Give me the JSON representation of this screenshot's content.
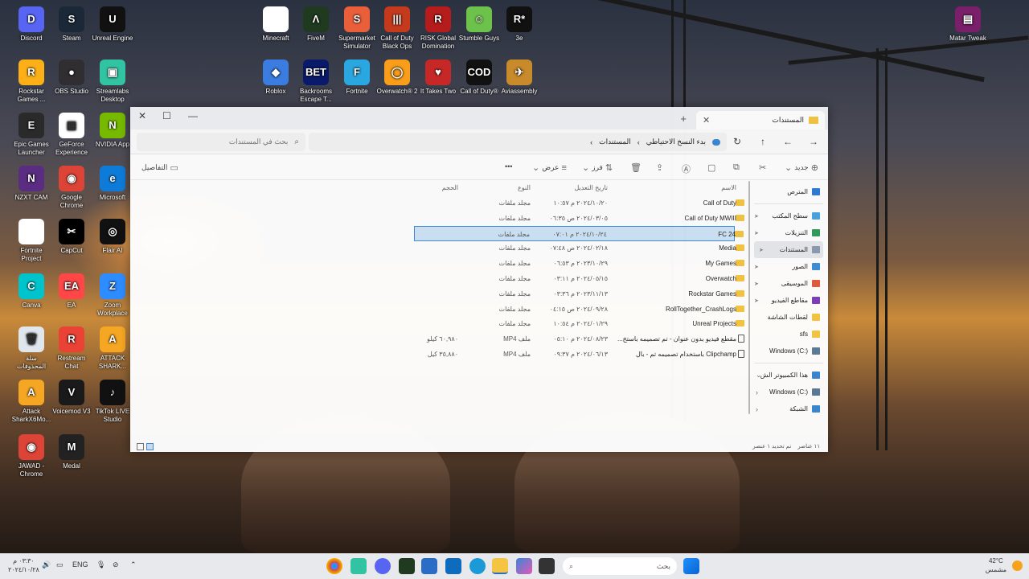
{
  "desktop": {
    "icons": [
      {
        "label": "Discord",
        "color": "#5865F2",
        "glyph": "D"
      },
      {
        "label": "Steam",
        "color": "#1b2838",
        "glyph": "S"
      },
      {
        "label": "Unreal Engine",
        "color": "#111111",
        "glyph": "U"
      },
      {
        "label": "Rockstar Games ...",
        "color": "#fcaf17",
        "glyph": "R"
      },
      {
        "label": "OBS Studio",
        "color": "#302e31",
        "glyph": "●"
      },
      {
        "label": "Streamlabs Desktop",
        "color": "#31c3a2",
        "glyph": "▣"
      },
      {
        "label": "Epic Games Launcher",
        "color": "#2a2a2a",
        "glyph": "E"
      },
      {
        "label": "GeForce Experience",
        "color": "#ffffff",
        "glyph": "▦"
      },
      {
        "label": "NVIDIA App",
        "color": "#76b900",
        "glyph": "N"
      },
      {
        "label": "NZXT CAM",
        "color": "#5a2d82",
        "glyph": "N"
      },
      {
        "label": "Google Chrome",
        "color": "#db4437",
        "glyph": "◉"
      },
      {
        "label": "Microsoft",
        "color": "#0f7bd8",
        "glyph": "e"
      },
      {
        "label": "Fortnite Project",
        "color": "#ffffff",
        "glyph": ""
      },
      {
        "label": "CapCut",
        "color": "#000000",
        "glyph": "✂"
      },
      {
        "label": "Flair AI",
        "color": "#111111",
        "glyph": "◎"
      },
      {
        "label": "Canva",
        "color": "#00c4cc",
        "glyph": "C"
      },
      {
        "label": "EA",
        "color": "#ff4747",
        "glyph": "EA"
      },
      {
        "label": "Zoom Workplace",
        "color": "#2d8cff",
        "glyph": "Z"
      },
      {
        "label": "سلة المحذوفات",
        "color": "#dfe6ee",
        "glyph": "🗑"
      },
      {
        "label": "Restream Chat",
        "color": "#ea4335",
        "glyph": "R"
      },
      {
        "label": "ATTACK SHARK...",
        "color": "#f5a623",
        "glyph": "A"
      },
      {
        "label": "Attack SharkX6Mo...",
        "color": "#f5a623",
        "glyph": "A"
      },
      {
        "label": "Voicemod V3",
        "color": "#1a1a1a",
        "glyph": "V"
      },
      {
        "label": "TikTok LIVE Studio",
        "color": "#111111",
        "glyph": "♪"
      },
      {
        "label": "JAWAD - Chrome",
        "color": "#db4437",
        "glyph": "◉"
      },
      {
        "label": "Medal",
        "color": "#222222",
        "glyph": "M"
      },
      {
        "label": "Minecraft",
        "color": "#ffffff",
        "glyph": ""
      },
      {
        "label": "FiveM",
        "color": "#1f3a1f",
        "glyph": "Λ"
      },
      {
        "label": "Supermarket Simulator",
        "color": "#e85f3a",
        "glyph": "S"
      },
      {
        "label": "Call of Duty Black Ops",
        "color": "#c53a1c",
        "glyph": "|||"
      },
      {
        "label": "RISK Global Domination",
        "color": "#b71c1c",
        "glyph": "R"
      },
      {
        "label": "Stumble Guys",
        "color": "#6cc24a",
        "glyph": "☺"
      },
      {
        "label": "3e",
        "color": "#111111",
        "glyph": "R*"
      },
      {
        "label": "Roblox",
        "color": "#3a7ce0",
        "glyph": "◆"
      },
      {
        "label": "Backrooms Escape T...",
        "color": "#0a1a6a",
        "glyph": "BET"
      },
      {
        "label": "Fortnite",
        "color": "#2aa7e0",
        "glyph": "F"
      },
      {
        "label": "Overwatch® 2",
        "color": "#f99e1a",
        "glyph": "◯"
      },
      {
        "label": "It Takes Two",
        "color": "#c62828",
        "glyph": "♥"
      },
      {
        "label": "Call of Duty®",
        "color": "#111111",
        "glyph": "COD"
      },
      {
        "label": "Aviassembly",
        "color": "#c88a2a",
        "glyph": "✈"
      },
      {
        "label": "Matar Tweak",
        "color": "#7a1f6a",
        "glyph": "▤"
      }
    ]
  },
  "explorer": {
    "tab_title": "المستندات",
    "tab_close": "✕",
    "new_tab": "+",
    "window_controls": {
      "minimize": "—",
      "maximize": "☐",
      "close": "✕"
    },
    "nav": {
      "back": "→",
      "forward": "←",
      "up": "↑",
      "refresh": "↻"
    },
    "breadcrumb": {
      "root": "بدء النسخ الاحتياطي",
      "sep1": "›",
      "current": "المستندات",
      "sep2": "›"
    },
    "search_placeholder": "بحث في المستندات",
    "toolbar": {
      "new": "جديد",
      "sort": "فرز",
      "view": "عرض",
      "more": "•••",
      "details": "التفاصيل"
    },
    "columns": {
      "name": "الاسم",
      "date": "تاريخ التعديل",
      "type": "النوع",
      "size": "الحجم"
    },
    "files": [
      {
        "name": "Call of Duty",
        "date": "٢٠٢٤/١٠/٢٠ م ١٠:٥٧",
        "type": "مجلد ملفات",
        "size": "",
        "kind": "folder",
        "selected": false
      },
      {
        "name": "Call of Duty MWIII",
        "date": "٢٠٢٤/٠٣/٠٥ ص ٠٦:٣٥",
        "type": "مجلد ملفات",
        "size": "",
        "kind": "folder",
        "selected": false
      },
      {
        "name": "FC 24",
        "date": "٢٠٢٤/١٠/٢٤ م ٠٧:٠١",
        "type": "مجلد ملفات",
        "size": "",
        "kind": "folder",
        "selected": true
      },
      {
        "name": "Media",
        "date": "٢٠٢٤/٠٢/١٨ ص ٠٧:٤٨",
        "type": "مجلد ملفات",
        "size": "",
        "kind": "folder",
        "selected": false
      },
      {
        "name": "My Games",
        "date": "٢٠٢٣/١٠/٢٩ م ٠٦:٥٣",
        "type": "مجلد ملفات",
        "size": "",
        "kind": "folder",
        "selected": false
      },
      {
        "name": "Overwatch",
        "date": "٢٠٢٤/٠٥/١٥ م ٠٣:١١",
        "type": "مجلد ملفات",
        "size": "",
        "kind": "folder",
        "selected": false
      },
      {
        "name": "Rockstar Games",
        "date": "٢٠٢٣/١١/١٣ م ٠٣:٣٦",
        "type": "مجلد ملفات",
        "size": "",
        "kind": "folder",
        "selected": false
      },
      {
        "name": "RollTogether_CrashLogs",
        "date": "٢٠٢٤/٠٩/٢٨ ص ٠٤:١٥",
        "type": "مجلد ملفات",
        "size": "",
        "kind": "folder",
        "selected": false
      },
      {
        "name": "Unreal Projects",
        "date": "٢٠٢٤/٠١/٢٩ م ١٠:٥٤",
        "type": "مجلد ملفات",
        "size": "",
        "kind": "folder",
        "selected": false
      },
      {
        "name": "مقطع فيديو بدون عنوان - تم تصميمه باستخ...",
        "date": "٢٠٢٤/٠٨/٢٣ م ٠٥:١٠",
        "type": "ملف MP4",
        "size": "٦٠,٩٨٠ كيلو",
        "kind": "video",
        "selected": false
      },
      {
        "name": "Clipchamp باستخدام تصميمه تم - بال",
        "date": "٢٠٢٤/٠٦/١٣ م ٠٩:٣٧",
        "type": "ملف MP4",
        "size": "٣٥,٨٨٠ كيل",
        "kind": "video",
        "selected": false
      }
    ],
    "sidebar": [
      {
        "label": "المترص",
        "color": "#2d7bd6",
        "active": false,
        "pin": false,
        "chev": false
      },
      {
        "label": "سطح المكتب",
        "color": "#4aa3df",
        "active": false,
        "pin": true,
        "chev": false
      },
      {
        "label": "التنزيلات",
        "color": "#2e9e58",
        "active": false,
        "pin": true,
        "chev": false
      },
      {
        "label": "المستندات",
        "color": "#8a9bb0",
        "active": true,
        "pin": true,
        "chev": false
      },
      {
        "label": "الصور",
        "color": "#3a8fd6",
        "active": false,
        "pin": true,
        "chev": false
      },
      {
        "label": "الموسيقى",
        "color": "#e05a3a",
        "active": false,
        "pin": true,
        "chev": false
      },
      {
        "label": "مقاطع الفيديو",
        "color": "#7b3fb8",
        "active": false,
        "pin": true,
        "chev": false
      },
      {
        "label": "لقطات الشاشة",
        "color": "#f4c542",
        "active": false,
        "pin": false,
        "chev": false
      },
      {
        "label": "sfs",
        "color": "#f4c542",
        "active": false,
        "pin": false,
        "chev": false
      },
      {
        "label": "Windows (C:)",
        "color": "#5a7a9a",
        "active": false,
        "pin": false,
        "chev": false
      },
      {
        "label": "هذا الكمبيوتر الش",
        "color": "#3a86d4",
        "active": false,
        "pin": false,
        "chev": true
      },
      {
        "label": "Windows (C:)",
        "color": "#5a7a9a",
        "active": false,
        "pin": false,
        "chev": true
      },
      {
        "label": "الشبكة",
        "color": "#3a86d4",
        "active": false,
        "pin": false,
        "chev": true
      }
    ],
    "status": {
      "count": "١١ عناصر",
      "selected": "تم تحديد ١ عنصر"
    }
  },
  "taskbar": {
    "search_placeholder": "بحث",
    "clock_time": "٠٣:٣٠ م",
    "clock_date": "٢٠٢٤/١٠/٢٨",
    "language": "ENG",
    "weather_temp": "42°C",
    "weather_desc": "مشمس"
  }
}
